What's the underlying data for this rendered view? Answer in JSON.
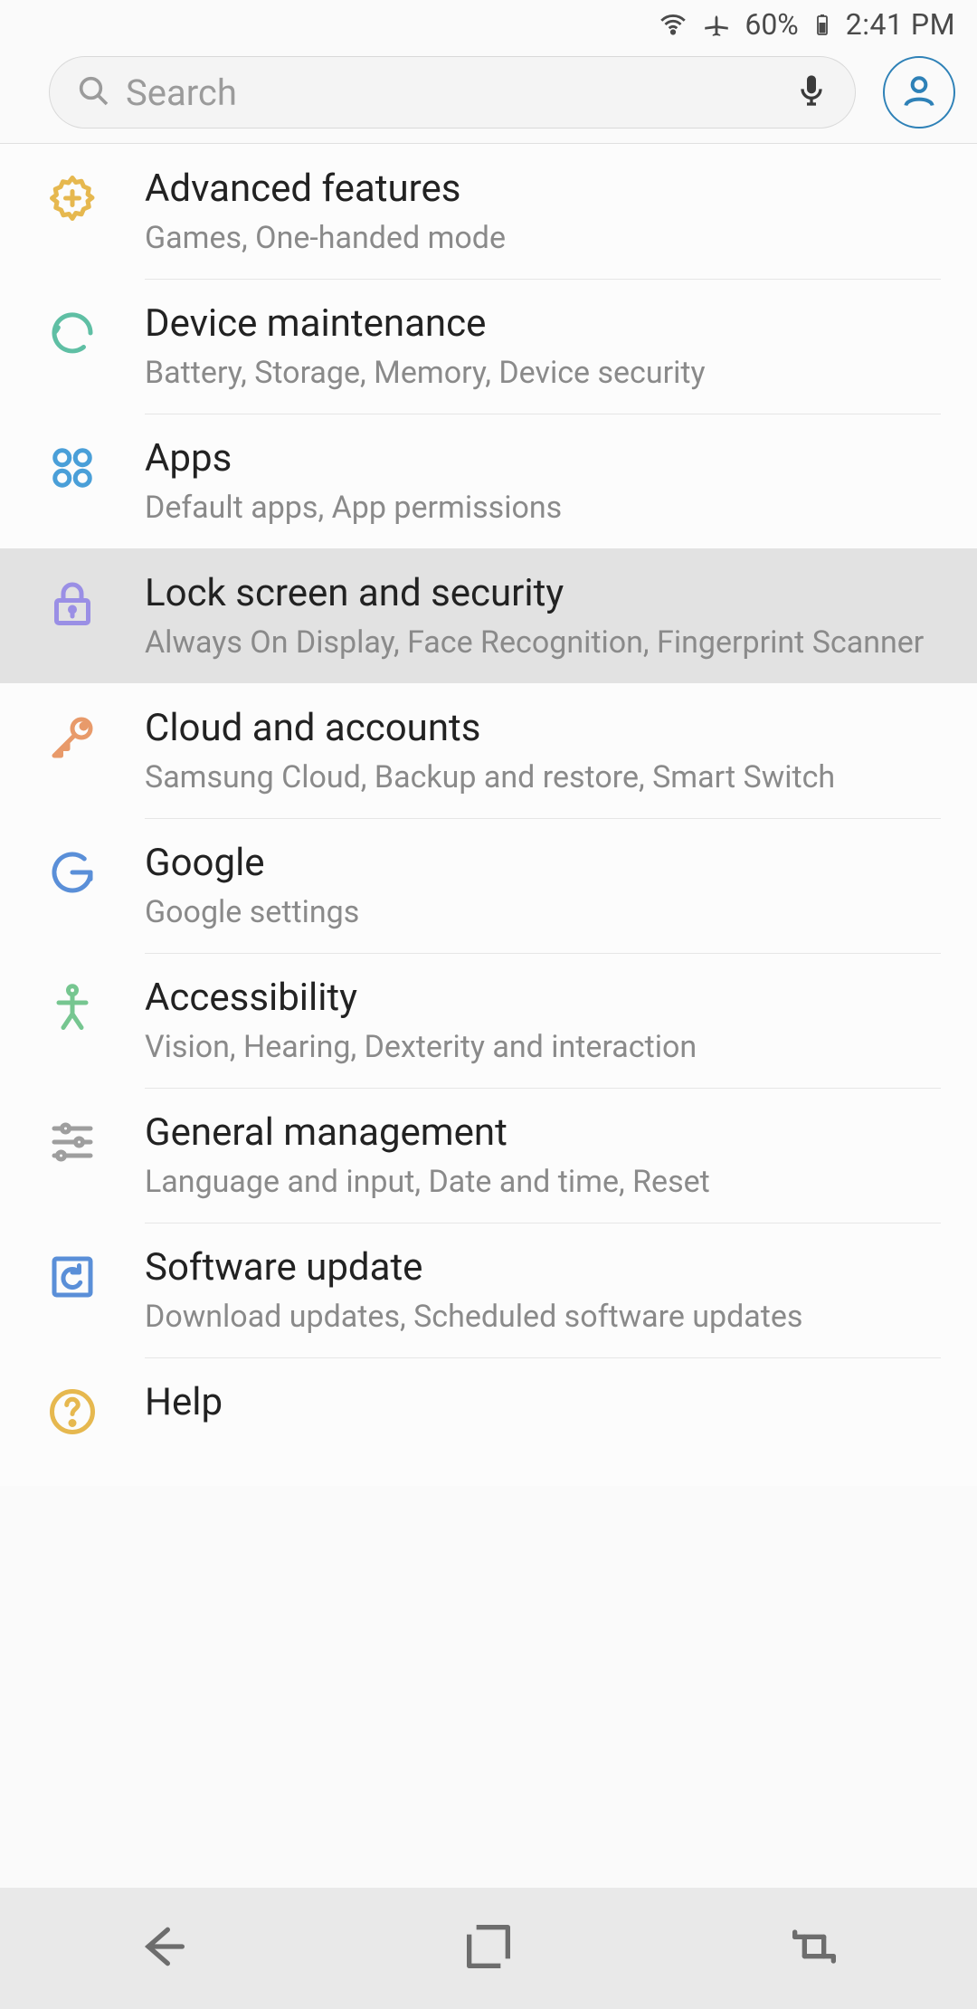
{
  "status": {
    "battery_text": "60%",
    "time": "2:41 PM"
  },
  "search": {
    "placeholder": "Search"
  },
  "items": [
    {
      "title": "Advanced features",
      "subtitle": "Games, One-handed mode",
      "icon": "gear-plus",
      "color": "#e6b84f"
    },
    {
      "title": "Device maintenance",
      "subtitle": "Battery, Storage, Memory, Device security",
      "icon": "cycle",
      "color": "#5fbfa4"
    },
    {
      "title": "Apps",
      "subtitle": "Default apps, App permissions",
      "icon": "four-circles",
      "color": "#4a9fd8"
    },
    {
      "title": "Lock screen and security",
      "subtitle": "Always On Display, Face Recognition, Fingerprint Scanner",
      "icon": "lock",
      "color": "#9a8fe5",
      "selected": true
    },
    {
      "title": "Cloud and accounts",
      "subtitle": "Samsung Cloud, Backup and restore, Smart Switch",
      "icon": "key",
      "color": "#e89a6a"
    },
    {
      "title": "Google",
      "subtitle": "Google settings",
      "icon": "google",
      "color": "#5a8fd8"
    },
    {
      "title": "Accessibility",
      "subtitle": "Vision, Hearing, Dexterity and interaction",
      "icon": "person",
      "color": "#76c690"
    },
    {
      "title": "General management",
      "subtitle": "Language and input, Date and time, Reset",
      "icon": "sliders",
      "color": "#9e9e9e"
    },
    {
      "title": "Software update",
      "subtitle": "Download updates, Scheduled software updates",
      "icon": "update-box",
      "color": "#5a8fd8"
    },
    {
      "title": "Help",
      "subtitle": "",
      "icon": "help",
      "color": "#e6b84f"
    }
  ]
}
